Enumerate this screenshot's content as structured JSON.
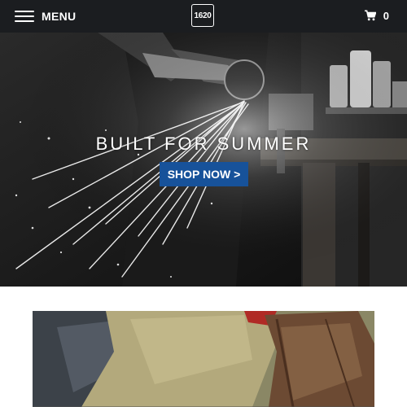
{
  "header": {
    "menu_label": "MENU",
    "logo_text": "1620",
    "cart_count": "0",
    "background": "#1b1d20"
  },
  "hero": {
    "title": "BUILT FOR SUMMER",
    "cta_label": "SHOP NOW >",
    "cta_color": "#17529a",
    "image": "worker-with-angle-grinder-sparks"
  },
  "promo": {
    "image": "tan-canvas-and-leather-gloves"
  },
  "icons": {
    "menu": "hamburger-icon",
    "cart": "cart-icon"
  }
}
